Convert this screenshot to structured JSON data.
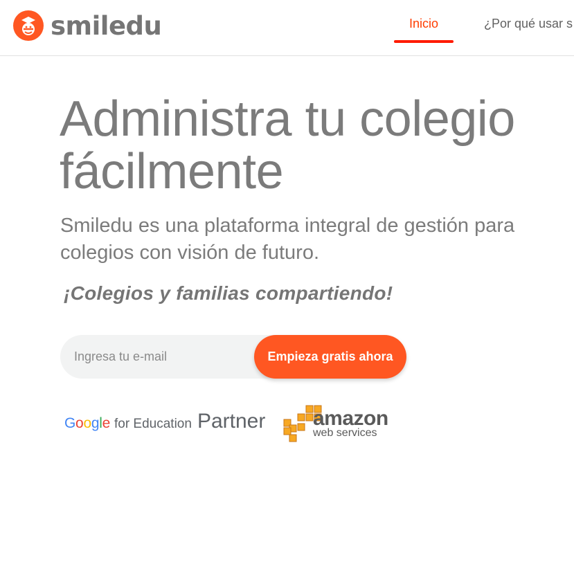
{
  "header": {
    "logo_text": "smiledu",
    "nav": [
      {
        "label": "Inicio",
        "active": true
      },
      {
        "label": "¿Por qué usar s",
        "active": false
      }
    ]
  },
  "hero": {
    "title_line1": "Administra tu colegio",
    "title_line2": "fácilmente",
    "subtitle_line1": "Smiledu es una plataforma integral de gestión para",
    "subtitle_line2": "colegios con visión de futuro.",
    "tagline": "¡Colegios y familias compartiendo!"
  },
  "signup": {
    "email_placeholder": "Ingresa tu e-mail",
    "email_value": "",
    "cta_label": "Empieza gratis ahora"
  },
  "partners": {
    "google_word": [
      "G",
      "o",
      "o",
      "g",
      "l",
      "e"
    ],
    "google_for": "for Education",
    "google_partner": "Partner",
    "aws_main": "amazon",
    "aws_sub": "web services"
  },
  "colors": {
    "accent": "#ff5722",
    "nav_active": "#ff3d00",
    "text": "#757575"
  },
  "icons": {
    "logo": "smiledu-logo-icon",
    "aws": "aws-cubes-icon"
  }
}
